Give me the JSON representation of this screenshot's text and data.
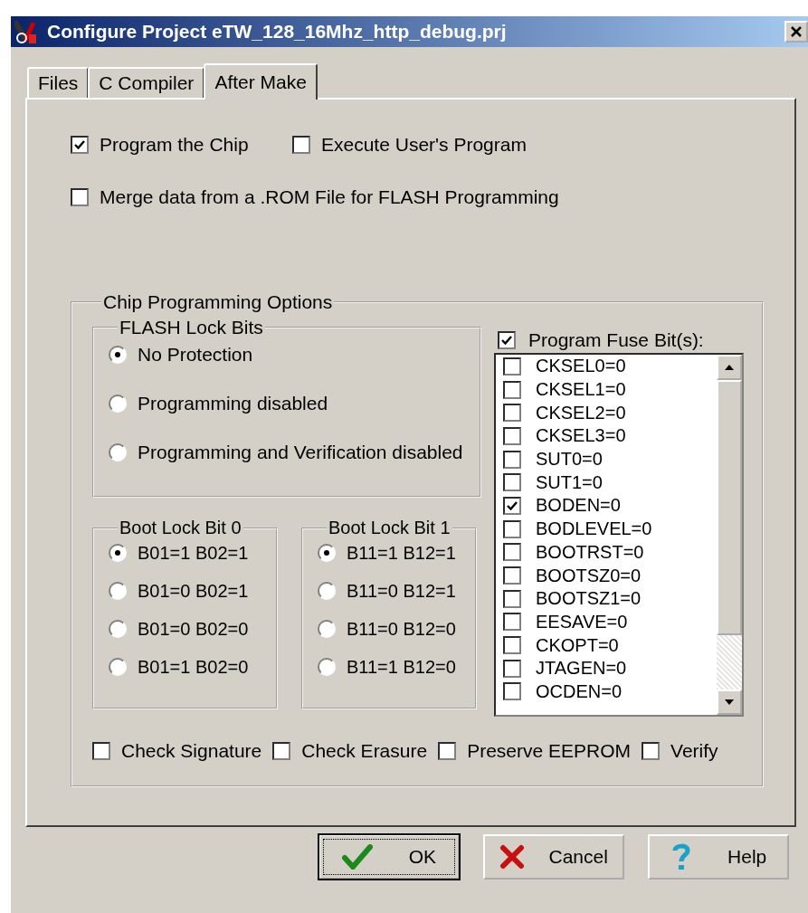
{
  "window": {
    "title": "Configure Project eTW_128_16Mhz_http_debug.prj"
  },
  "tabs": [
    {
      "label": "Files",
      "selected": false
    },
    {
      "label": "C Compiler",
      "selected": false
    },
    {
      "label": "After Make",
      "selected": true
    }
  ],
  "options": [
    {
      "label": "Program the Chip",
      "checked": true
    },
    {
      "label": "Execute User's Program",
      "checked": false
    },
    {
      "label": "Merge data from a .ROM File for FLASH Programming",
      "checked": false
    }
  ],
  "chip_programming": {
    "title": "Chip Programming Options",
    "flash_lock_bits": {
      "title": "FLASH Lock Bits",
      "options": [
        {
          "label": "No Protection",
          "selected": true
        },
        {
          "label": "Programming disabled",
          "selected": false
        },
        {
          "label": "Programming and Verification disabled",
          "selected": false
        }
      ]
    },
    "boot_lock_bits": [
      {
        "title": "Boot Lock Bit 0",
        "options": [
          {
            "label": "B01=1 B02=1",
            "selected": true
          },
          {
            "label": "B01=0 B02=1",
            "selected": false
          },
          {
            "label": "B01=0 B02=0",
            "selected": false
          },
          {
            "label": "B01=1 B02=0",
            "selected": false
          }
        ]
      },
      {
        "title": "Boot Lock Bit 1",
        "options": [
          {
            "label": "B11=1 B12=1",
            "selected": true
          },
          {
            "label": "B11=0 B12=1",
            "selected": false
          },
          {
            "label": "B11=0 B12=0",
            "selected": false
          },
          {
            "label": "B11=1 B12=0",
            "selected": false
          }
        ]
      }
    ],
    "program_fuse_bits": {
      "label": "Program Fuse Bit(s):",
      "checked": true
    },
    "fuse_bits": [
      {
        "label": "CKSEL0=0",
        "checked": false
      },
      {
        "label": "CKSEL1=0",
        "checked": false
      },
      {
        "label": "CKSEL2=0",
        "checked": false
      },
      {
        "label": "CKSEL3=0",
        "checked": false
      },
      {
        "label": "SUT0=0",
        "checked": false
      },
      {
        "label": "SUT1=0",
        "checked": false
      },
      {
        "label": "BODEN=0",
        "checked": true
      },
      {
        "label": "BODLEVEL=0",
        "checked": false
      },
      {
        "label": "BOOTRST=0",
        "checked": false
      },
      {
        "label": "BOOTSZ0=0",
        "checked": false
      },
      {
        "label": "BOOTSZ1=0",
        "checked": false
      },
      {
        "label": "EESAVE=0",
        "checked": false
      },
      {
        "label": "CKOPT=0",
        "checked": false
      },
      {
        "label": "JTAGEN=0",
        "checked": false
      },
      {
        "label": "OCDEN=0",
        "checked": false
      }
    ],
    "checks": [
      {
        "label": "Check Signature",
        "checked": false
      },
      {
        "label": "Check Erasure",
        "checked": false
      },
      {
        "label": "Preserve EEPROM",
        "checked": false
      },
      {
        "label": "Verify",
        "checked": false
      }
    ]
  },
  "buttons": [
    {
      "label": "OK",
      "kind": "ok",
      "default": true
    },
    {
      "label": "Cancel",
      "kind": "cancel",
      "default": false
    },
    {
      "label": "Help",
      "kind": "help",
      "default": false
    }
  ]
}
